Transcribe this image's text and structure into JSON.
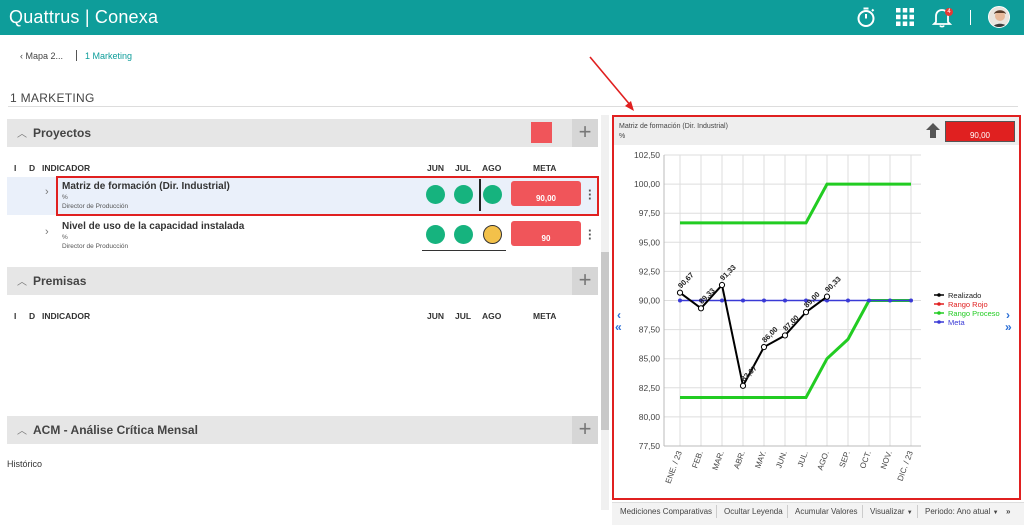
{
  "app": {
    "brand": "Quattrus | Conexa",
    "notifications_count": "4"
  },
  "breadcrumb": {
    "back_label": "Mapa 2...",
    "current": "1 Marketing"
  },
  "page_title": "1 MARKETING",
  "sections": {
    "proyectos": {
      "label": "Proyectos"
    },
    "premisas": {
      "label": "Premisas"
    },
    "acm": {
      "label": "ACM - Análise Crítica Mensal"
    }
  },
  "columns": {
    "i": "I",
    "d": "D",
    "indicador": "INDICADOR",
    "jun": "JUN",
    "jul": "JUL",
    "ago": "AGO",
    "meta": "META"
  },
  "indicators": [
    {
      "title": "Matriz de formación (Dir. Industrial)",
      "unit": "%",
      "owner": "Director de Producción",
      "meta": "90,00",
      "status": [
        "green",
        "green",
        "green"
      ]
    },
    {
      "title": "Nivel de uso de la capacidad instalada",
      "unit": "%",
      "owner": "Director de Producción",
      "meta": "90",
      "status": [
        "green",
        "green",
        "yellow"
      ]
    }
  ],
  "historico_label": "Histórico",
  "chart_panel": {
    "title": "Matriz de formación (Dir. Industrial)",
    "unit": "%",
    "value": "90,00"
  },
  "chart_data": {
    "type": "line",
    "categories": [
      "ENE. / 23",
      "FEB.",
      "MAR.",
      "ABR.",
      "MAY.",
      "JUN.",
      "JUL.",
      "AGO.",
      "SEP.",
      "OCT.",
      "NOV.",
      "DIC. / 23"
    ],
    "ylim": [
      77.5,
      102.5
    ],
    "yticks": [
      "102,50",
      "100,00",
      "97,50",
      "95,00",
      "92,50",
      "90,00",
      "87,50",
      "85,00",
      "82,50",
      "80,00",
      "77,50"
    ],
    "ytick_values": [
      102.5,
      100,
      97.5,
      95,
      92.5,
      90,
      87.5,
      85,
      82.5,
      80,
      77.5
    ],
    "grid": true,
    "legend_position": "right",
    "series": [
      {
        "name": "Realizado",
        "color": "#000000",
        "values": [
          90.67,
          89.33,
          91.33,
          82.67,
          86.0,
          87.0,
          89.0,
          90.33,
          null,
          null,
          null,
          null
        ],
        "labels": [
          "90,67",
          "89,33",
          "91,33",
          "82,67",
          "86,00",
          "87,00",
          "89,00",
          "90,33"
        ]
      },
      {
        "name": "Rango Rojo",
        "color": "#e02020",
        "values": []
      },
      {
        "name": "Rango Proceso",
        "color": "#22cc22",
        "upper": [
          96.67,
          96.67,
          96.67,
          96.67,
          96.67,
          96.67,
          96.67,
          100,
          100,
          100,
          100,
          100
        ],
        "lower": [
          81.67,
          81.67,
          81.67,
          81.67,
          81.67,
          81.67,
          81.67,
          85,
          86.67,
          90,
          90,
          90
        ]
      },
      {
        "name": "Meta",
        "color": "#3a3ad6",
        "values": [
          90,
          90,
          90,
          90,
          90,
          90,
          90,
          90,
          90,
          90,
          90,
          90
        ]
      }
    ]
  },
  "toolbar": {
    "mediciones": "Mediciones Comparativas",
    "ocultar": "Ocultar Leyenda",
    "acumular": "Acumular Valores",
    "visualizar": "Visualizar",
    "periodo": "Periodo: Ano atual"
  }
}
